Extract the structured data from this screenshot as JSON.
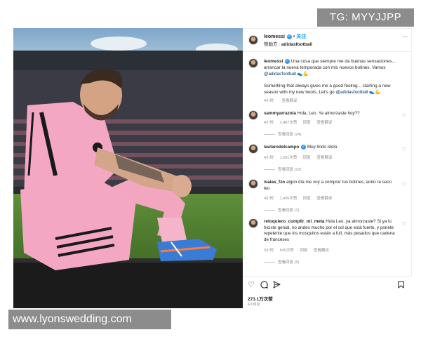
{
  "watermarks": {
    "top": "TG: MYYJJPP",
    "bottom": "www.lyonswedding.com"
  },
  "post": {
    "username": "leomessi",
    "follow_label": "关注",
    "sponsor_prefix": "赞助方 : ",
    "sponsor_name": "adidasfootball",
    "more_icon": "more-dots-icon"
  },
  "caption": {
    "username": "leomessi",
    "text_es": "Una cosa que siempre me da buenas sensaciones... arrancar la nueva temporada con mis nuevos botines. Vamos ",
    "mention_es": "@adidasfootball",
    "emoji_es": " 👟💪",
    "text_en": "Something that always gives me a good feeling... starting a new season with my new boots. Let's go ",
    "mention_en": "@adidasfootball",
    "emoji_en": " 👟💪",
    "time": "4小时",
    "translate": "查看翻译"
  },
  "comments": [
    {
      "username": "sammyarrazola",
      "text": "Hola, Leo. Ya almorzaste hoy??",
      "time": "4小时",
      "likes": "2,487次赞",
      "reply": "回复",
      "translate": "查看翻译",
      "replies": "查看回复 (24)"
    },
    {
      "username": "lautarodelcampo",
      "text": "Muy lindo ídolo.",
      "time": "4小时",
      "likes": "1,691次赞",
      "reply": "回复",
      "translate": "查看翻译",
      "replies": "查看回复 (23)"
    },
    {
      "username": "isaias_fzo",
      "text": "algún día me voy a comprar tus botines, ando re seco leo",
      "time": "4小时",
      "likes": "1,406次赞",
      "reply": "回复",
      "translate": "查看翻译",
      "replies": "查看回复 (1)"
    },
    {
      "username": "retoquiero_cumplir_mi_meta",
      "text": "Hola Leo, ya almorzaste? Si ya lo hiciste genial, no andes mucho por el sol que está fuerte, y ponete repelente que los mosquitos están a full, más pesados que cadena de franceses",
      "time": "3小时",
      "likes": "645次赞",
      "reply": "回复",
      "translate": "查看翻译",
      "replies": "查看回复 (5)"
    }
  ],
  "actions": {
    "like_icon": "heart-icon",
    "comment_icon": "comment-icon",
    "share_icon": "share-icon",
    "save_icon": "bookmark-icon"
  },
  "likes_count": "273.1万次赞",
  "post_time": "4小时前",
  "colors": {
    "link": "#0095f6",
    "verified": "#3897f0",
    "shirt": "#f4a7c3",
    "boot": "#3a7bd5"
  }
}
